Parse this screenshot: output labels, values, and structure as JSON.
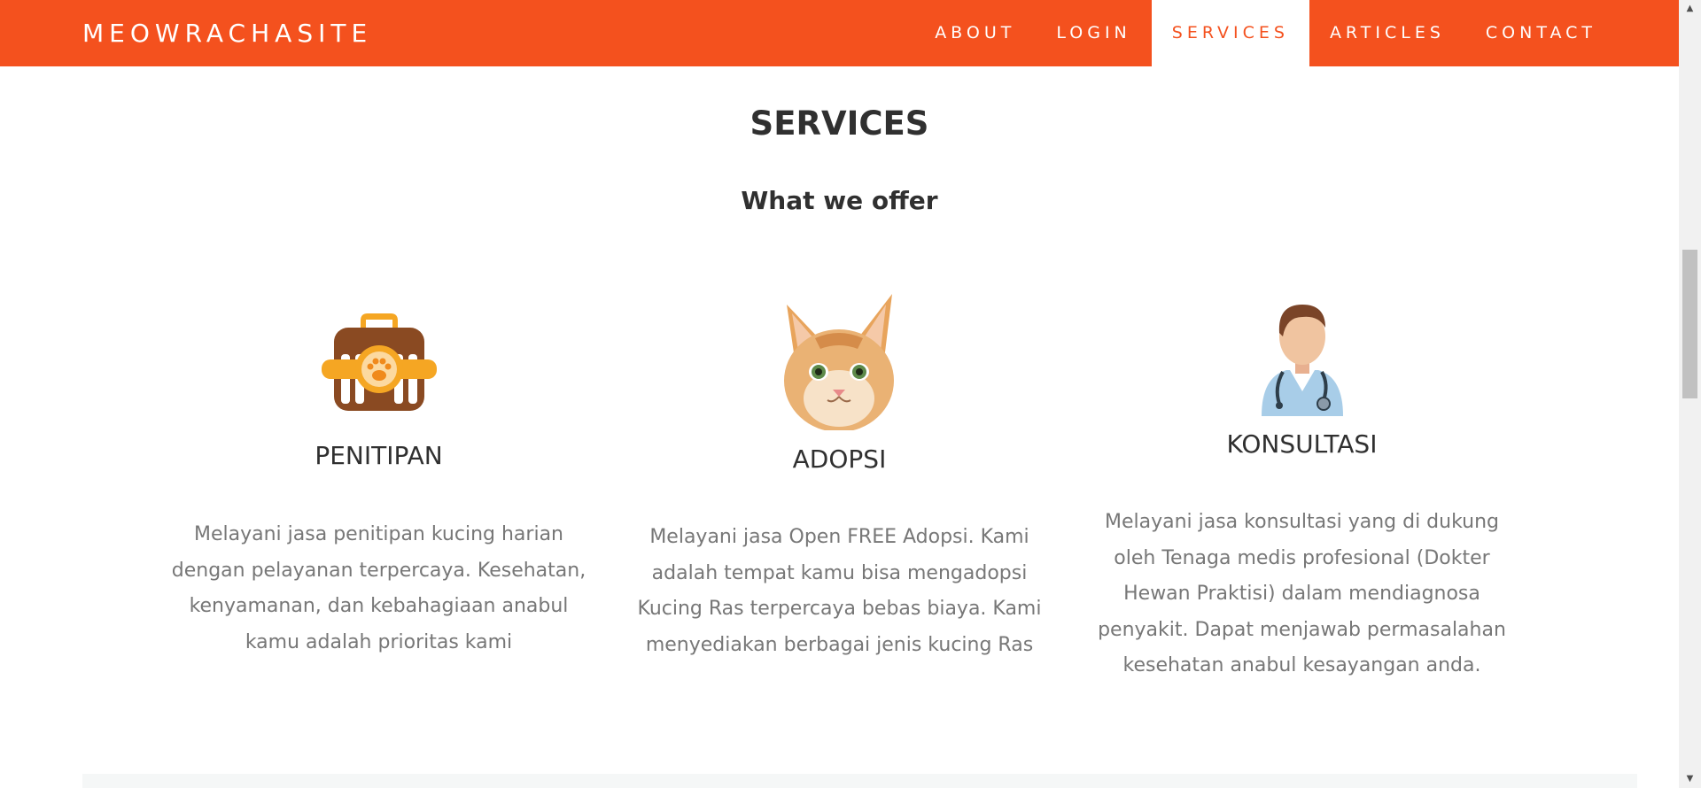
{
  "navbar": {
    "brand": "MEOWRACHASITE",
    "items": [
      {
        "label": "ABOUT",
        "active": false
      },
      {
        "label": "LOGIN",
        "active": false
      },
      {
        "label": "SERVICES",
        "active": true
      },
      {
        "label": "ARTICLES",
        "active": false
      },
      {
        "label": "CONTACT",
        "active": false
      }
    ]
  },
  "colors": {
    "accent": "#f4511e",
    "heading": "#303030",
    "body_text": "#777777"
  },
  "section": {
    "title": "SERVICES",
    "subtitle": "What we offer"
  },
  "services": [
    {
      "icon": "pet-carrier-icon",
      "title": "PENITIPAN",
      "description": "Melayani jasa penitipan kucing harian dengan pelayanan terpercaya. Kesehatan, kenyamanan, dan kebahagiaan anabul kamu adalah prioritas kami"
    },
    {
      "icon": "cat-photo",
      "title": "ADOPSI",
      "description": "Melayani jasa Open FREE Adopsi. Kami adalah tempat kamu bisa mengadopsi Kucing Ras terpercaya bebas biaya. Kami menyediakan berbagai jenis kucing Ras"
    },
    {
      "icon": "doctor-icon",
      "title": "KONSULTASI",
      "description": "Melayani jasa konsultasi yang di dukung oleh Tenaga medis profesional (Dokter Hewan Praktisi) dalam mendiagnosa penyakit. Dapat menjawab permasalahan kesehatan anabul kesayangan anda."
    }
  ]
}
